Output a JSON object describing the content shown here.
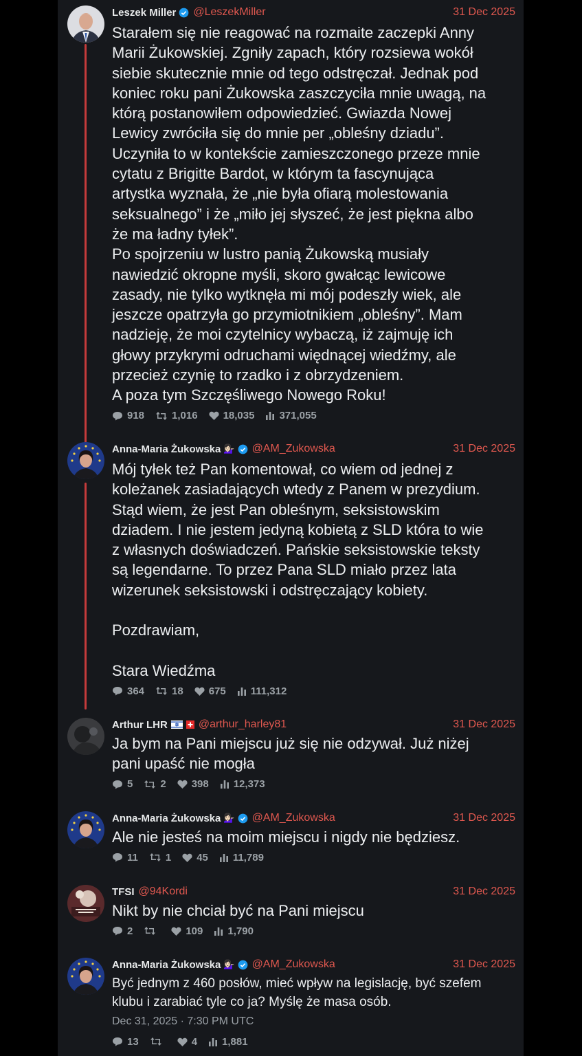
{
  "thread": [
    {
      "name": "Leszek Miller",
      "handle": "@LeszekMiller",
      "date": "31 Dec 2025",
      "verified": true,
      "text": "Starałem się nie reagować na rozmaite zaczepki Anny\nMarii Żukowskiej. Zgniły zapach, który rozsiewa wokół\nsiebie skutecznie mnie od tego odstręczał. Jednak pod\nkoniec roku pani Żukowska zaszczyciła mnie uwagą, na\nktórą postanowiłem odpowiedzieć. Gwiazda Nowej\nLewicy zwróciła się do mnie per „obleśny dziadu”.\nUczyniła to w kontekście zamieszczonego przeze mnie\ncytatu z Brigitte Bardot, w którym ta fascynująca\nartystka wyznała, że „nie była ofiarą molestowania\nseksualnego” i że „miło jej słyszeć, że jest piękna albo\nże ma ładny tyłek”.\nPo spojrzeniu w lustro panią Żukowską musiały\nnawiedzić okropne myśli, skoro gwałcąc lewicowe\nzasady, nie tylko wytknęła mi mój podeszły wiek, ale\njeszcze opatrzyła go przymiotnikiem „obleśny”. Mam\nnadzieję, że moi czytelnicy wybaczą, iż zajmuję ich\ngłowy przykrymi odruchami więdnącej wiedźmy, ale\nprzecież czynię to rzadko i z obrzydzeniem.\nA poza tym Szczęśliwego Nowego Roku!",
      "replies": "918",
      "retweets": "1,016",
      "likes": "18,035",
      "views": "371,055"
    },
    {
      "name": "Anna-Maria Żukowska",
      "emoji": "💁🏻‍♀️",
      "handle": "@AM_Zukowska",
      "date": "31 Dec 2025",
      "verified": true,
      "text": "Mój tyłek też Pan komentował, co wiem od jednej z\nkoleżanek zasiadających wtedy z Panem w prezydium.\nStąd wiem, że jest Pan obleśnym, seksistowskim\ndziadem. I nie jestem jedyną kobietą z SLD która to wie\nz własnych doświadczeń. Pańskie seksistowskie teksty\nsą legendarne. To przez Pana SLD miało przez lata\nwizerunek seksistowski i odstręczający kobiety.\n\nPozdrawiam,\n\nStara Wiedźma",
      "replies": "364",
      "retweets": "18",
      "likes": "675",
      "views": "111,312"
    },
    {
      "name": "Arthur LHR",
      "handle": "@arthur_harley81",
      "date": "31 Dec 2025",
      "verified": false,
      "text": "Ja bym na Pani miejscu już się nie odzywał. Już niżej\npani upaść nie mogła",
      "replies": "5",
      "retweets": "2",
      "likes": "398",
      "views": "12,373"
    },
    {
      "name": "Anna-Maria Żukowska",
      "emoji": "💁🏻‍♀️",
      "handle": "@AM_Zukowska",
      "date": "31 Dec 2025",
      "verified": true,
      "text": "Ale nie jesteś na moim miejscu i nigdy nie będziesz.",
      "replies": "11",
      "retweets": "1",
      "likes": "45",
      "views": "11,789"
    },
    {
      "name": "TFSI",
      "handle": "@94Kordi",
      "date": "31 Dec 2025",
      "verified": false,
      "text": "Nikt by nie chciał być na Pani miejscu",
      "replies": "2",
      "retweets": "",
      "likes": "109",
      "views": "1,790"
    },
    {
      "name": "Anna-Maria Żukowska",
      "emoji": "💁🏻‍♀️",
      "handle": "@AM_Zukowska",
      "date": "31 Dec 2025",
      "verified": true,
      "text": "Być jednym z 460 posłów, mieć wpływ na legislację, być szefem\nklubu i zarabiać tyle co ja? Myślę że masa osób.",
      "timestamp": "Dec 31, 2025 · 7:30 PM UTC",
      "replies": "13",
      "retweets": "",
      "likes": "4",
      "views": "1,881"
    }
  ],
  "icons": {
    "reply": "reply-icon",
    "retweet": "retweet-icon",
    "like": "like-icon",
    "views": "views-icon",
    "verified": "verified-badge-icon"
  },
  "colors": {
    "accent": "#e0584f",
    "thread_line": "#c53b3b",
    "verified": "#1d9bf0",
    "background": "#16181c"
  }
}
